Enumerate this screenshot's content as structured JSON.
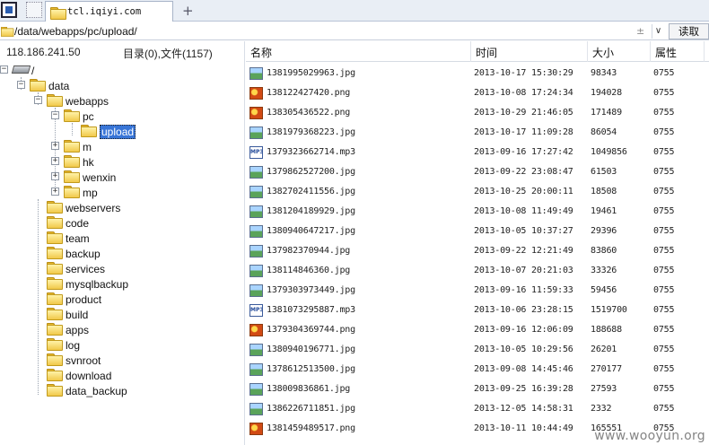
{
  "tab": {
    "title": "tcl.iqiyi.com",
    "new_tab": "+"
  },
  "address": {
    "path": "/data/webapps/pc/upload/",
    "plusminus": "±",
    "dropdown": "∨",
    "read_button": "读取"
  },
  "left_header": {
    "ip": "118.186.241.50",
    "dir_info": "目录(0),文件(1157)"
  },
  "tree": {
    "root": "/",
    "data": "data",
    "webapps": "webapps",
    "pc": "pc",
    "upload": "upload",
    "m": "m",
    "hk": "hk",
    "wenxin": "wenxin",
    "mp": "mp",
    "siblings": [
      "webservers",
      "code",
      "team",
      "backup",
      "services",
      "mysqlbackup",
      "product",
      "build",
      "apps",
      "log",
      "svnroot",
      "download",
      "data_backup"
    ]
  },
  "columns": {
    "name": "名称",
    "time": "时间",
    "size": "大小",
    "attr": "属性"
  },
  "files": [
    {
      "name": "1381995029963.jpg",
      "time": "2013-10-17 15:30:29",
      "size": "98343",
      "attr": "0755",
      "type": "jpg"
    },
    {
      "name": "138122427420.png",
      "time": "2013-10-08 17:24:34",
      "size": "194028",
      "attr": "0755",
      "type": "png"
    },
    {
      "name": "138305436522.png",
      "time": "2013-10-29 21:46:05",
      "size": "171489",
      "attr": "0755",
      "type": "png"
    },
    {
      "name": "1381979368223.jpg",
      "time": "2013-10-17 11:09:28",
      "size": "86054",
      "attr": "0755",
      "type": "jpg"
    },
    {
      "name": "1379323662714.mp3",
      "time": "2013-09-16 17:27:42",
      "size": "1049856",
      "attr": "0755",
      "type": "mp3"
    },
    {
      "name": "1379862527200.jpg",
      "time": "2013-09-22 23:08:47",
      "size": "61503",
      "attr": "0755",
      "type": "jpg"
    },
    {
      "name": "1382702411556.jpg",
      "time": "2013-10-25 20:00:11",
      "size": "18508",
      "attr": "0755",
      "type": "jpg"
    },
    {
      "name": "1381204189929.jpg",
      "time": "2013-10-08 11:49:49",
      "size": "19461",
      "attr": "0755",
      "type": "jpg"
    },
    {
      "name": "1380940647217.jpg",
      "time": "2013-10-05 10:37:27",
      "size": "29396",
      "attr": "0755",
      "type": "jpg"
    },
    {
      "name": "137982370944.jpg",
      "time": "2013-09-22 12:21:49",
      "size": "83860",
      "attr": "0755",
      "type": "jpg"
    },
    {
      "name": "138114846360.jpg",
      "time": "2013-10-07 20:21:03",
      "size": "33326",
      "attr": "0755",
      "type": "jpg"
    },
    {
      "name": "1379303973449.jpg",
      "time": "2013-09-16 11:59:33",
      "size": "59456",
      "attr": "0755",
      "type": "jpg"
    },
    {
      "name": "1381073295887.mp3",
      "time": "2013-10-06 23:28:15",
      "size": "1519700",
      "attr": "0755",
      "type": "mp3"
    },
    {
      "name": "1379304369744.png",
      "time": "2013-09-16 12:06:09",
      "size": "188688",
      "attr": "0755",
      "type": "png"
    },
    {
      "name": "1380940196771.jpg",
      "time": "2013-10-05 10:29:56",
      "size": "26201",
      "attr": "0755",
      "type": "jpg"
    },
    {
      "name": "1378612513500.jpg",
      "time": "2013-09-08 14:45:46",
      "size": "270177",
      "attr": "0755",
      "type": "jpg"
    },
    {
      "name": "138009836861.jpg",
      "time": "2013-09-25 16:39:28",
      "size": "27593",
      "attr": "0755",
      "type": "jpg"
    },
    {
      "name": "1386226711851.jpg",
      "time": "2013-12-05 14:58:31",
      "size": "2332",
      "attr": "0755",
      "type": "jpg"
    },
    {
      "name": "1381459489517.png",
      "time": "2013-10-11 10:44:49",
      "size": "165551",
      "attr": "0755",
      "type": "png"
    }
  ],
  "mp3_label": "MP3",
  "watermark": "www.wooyun.org"
}
